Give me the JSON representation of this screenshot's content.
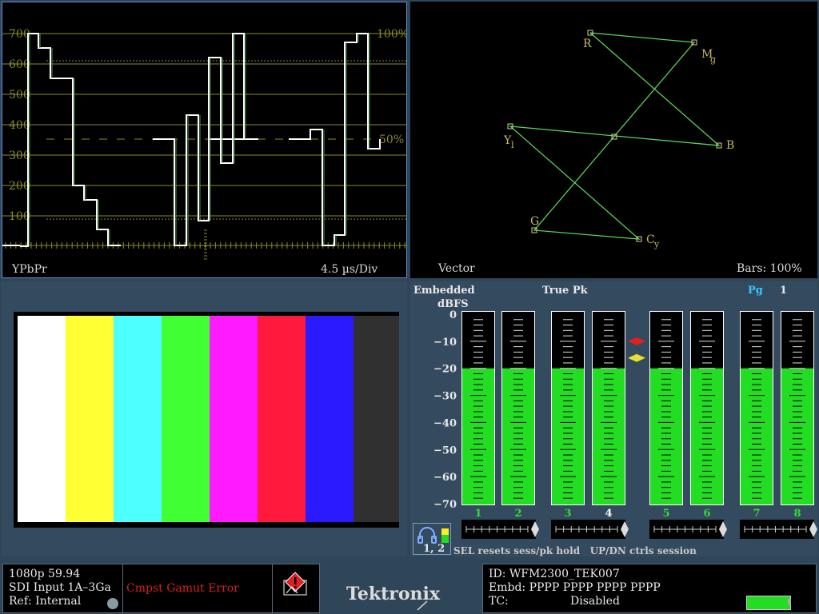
{
  "waveform": {
    "format_label": "YPbPr",
    "timebase_label": "4.5 µs/Div",
    "y_ticks": [
      "700",
      "600",
      "500",
      "400",
      "300",
      "200",
      "100"
    ],
    "pct_100": "100%",
    "pct_50": "50%",
    "trace_color": "#ffffff",
    "grid_color": "#8a8a2e"
  },
  "vector": {
    "title": "Vector",
    "bars_label": "Bars: 100%",
    "targets": {
      "r": "R",
      "mg": "M",
      "mg_sub": "g",
      "b": "B",
      "yl": "Y",
      "yl_sub": "l",
      "g": "G",
      "cy": "C",
      "cy_sub": "y"
    },
    "trace_color": "#58d158"
  },
  "picture": {
    "bar_colors": [
      "#ffffff",
      "#ffff33",
      "#4dffff",
      "#40ff33",
      "#ff1aff",
      "#ff1a3d",
      "#2b1aff",
      "#303030"
    ]
  },
  "audio": {
    "source_label": "Embedded",
    "units_label": "dBFS",
    "mode_label": "True Pk",
    "page_label": "Pg",
    "page_value": "1",
    "scale": [
      "0",
      "−10",
      "−20",
      "−30",
      "−40",
      "−50",
      "−60",
      "−70"
    ],
    "channel_labels": [
      "1",
      "2",
      "3",
      "4",
      "5",
      "6",
      "7",
      "8"
    ],
    "channel_levels_dbfs": [
      -20,
      -20,
      -20,
      -20,
      -20,
      -20,
      -20,
      -20
    ],
    "peak_marker_red_dbfs": -10,
    "peak_marker_yellow_dbfs": -20,
    "headphone_channels": "1, 2",
    "help_text": "SEL resets sess/pk hold   UP/DN ctrls session",
    "meter_color": "#22dd22"
  },
  "status": {
    "video_format": "1080p 59.94",
    "input": "SDI Input 1A–3Ga",
    "ref": "Ref: Internal",
    "error_text": "Cmpst Gamut Error",
    "error_color": "#d42020",
    "brand": "Tektronix",
    "id_line": "ID: WFM2300_TEK007",
    "embd_line": "Embd: PPPP PPPP PPPP PPPP",
    "tc_label": "TC:",
    "tc_value": "Disabled"
  }
}
